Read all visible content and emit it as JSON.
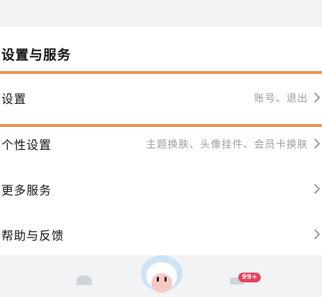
{
  "section": {
    "title": "设置与服务"
  },
  "rows": [
    {
      "label": "设置",
      "detail": "账号、退出"
    },
    {
      "label": "个性设置",
      "detail": "主题换肤、头像挂件、会员卡换肤"
    },
    {
      "label": "更多服务",
      "detail": ""
    },
    {
      "label": "帮助与反馈",
      "detail": ""
    }
  ],
  "tabbar": {
    "badge": "99+"
  },
  "colors": {
    "highlight": "#e8934a",
    "badge": "#e8415a",
    "detail_text": "#9a9aa2"
  }
}
